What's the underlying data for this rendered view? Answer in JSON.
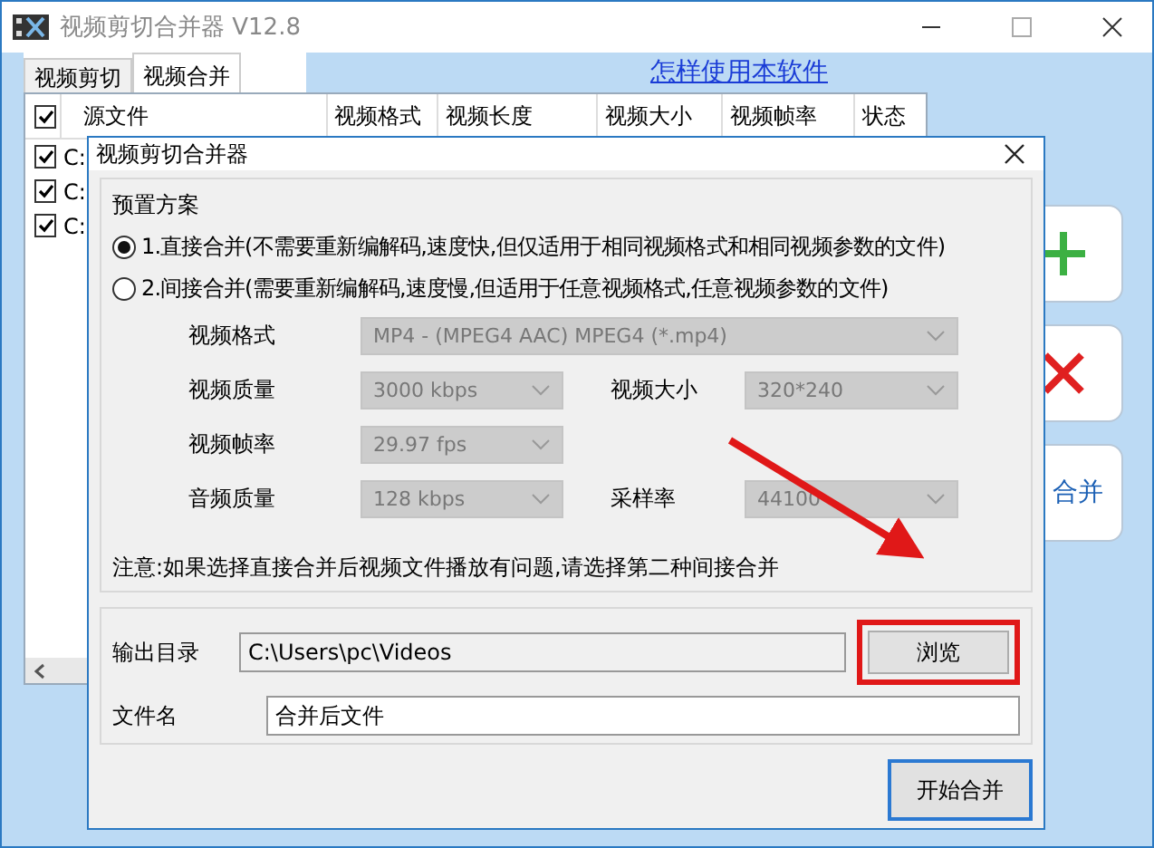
{
  "window": {
    "title": "视频剪切合并器 V12.8"
  },
  "tabs": [
    {
      "label": "视频剪切",
      "selected": false
    },
    {
      "label": "视频合并",
      "selected": true
    }
  ],
  "help_link": "怎样使用本软件",
  "file_table": {
    "all_checked": true,
    "columns": [
      "源文件",
      "视频格式",
      "视频长度",
      "视频大小",
      "视频帧率",
      "状态"
    ],
    "rows": [
      {
        "checked": true,
        "file": "C:"
      },
      {
        "checked": true,
        "file": "C:"
      },
      {
        "checked": true,
        "file": "C:"
      }
    ]
  },
  "side_buttons": [
    {
      "kind": "add"
    },
    {
      "kind": "remove"
    },
    {
      "kind": "merge",
      "label": "合并"
    }
  ],
  "dialog": {
    "title": "视频剪切合并器",
    "preset_group": "预置方案",
    "modes": [
      {
        "label": "1.直接合并(不需要重新编解码,速度快,但仅适用于相同视频格式和相同视频参数的文件)",
        "selected": true
      },
      {
        "label": "2.间接合并(需要重新编解码,速度慢,但适用于任意视频格式,任意视频参数的文件)",
        "selected": false
      }
    ],
    "settings": [
      [
        {
          "label": "视频格式",
          "value": "MP4 - (MPEG4 AAC) MPEG4 (*.mp4)",
          "kind": "wide",
          "disabled": true
        }
      ],
      [
        {
          "label": "视频质量",
          "value": "3000 kbps",
          "kind": "narrow",
          "disabled": true
        },
        {
          "label": "视频大小",
          "value": "320*240",
          "kind": "narrow",
          "disabled": true
        }
      ],
      [
        {
          "label": "视频帧率",
          "value": "29.97 fps",
          "kind": "narrow",
          "disabled": true
        }
      ],
      [
        {
          "label": "音频质量",
          "value": "128 kbps",
          "kind": "narrow",
          "disabled": true
        },
        {
          "label": "采样率",
          "value": "44100",
          "kind": "narrow",
          "disabled": true
        }
      ]
    ],
    "note": "注意:如果选择直接合并后视频文件播放有问题,请选择第二种间接合并",
    "output_dir": {
      "label": "输出目录",
      "value": "C:\\Users\\pc\\Videos"
    },
    "browse_button": {
      "label": "浏览",
      "highlighted": true
    },
    "file_name": {
      "label": "文件名",
      "value": "合并后文件"
    },
    "start_button": "开始合并"
  }
}
